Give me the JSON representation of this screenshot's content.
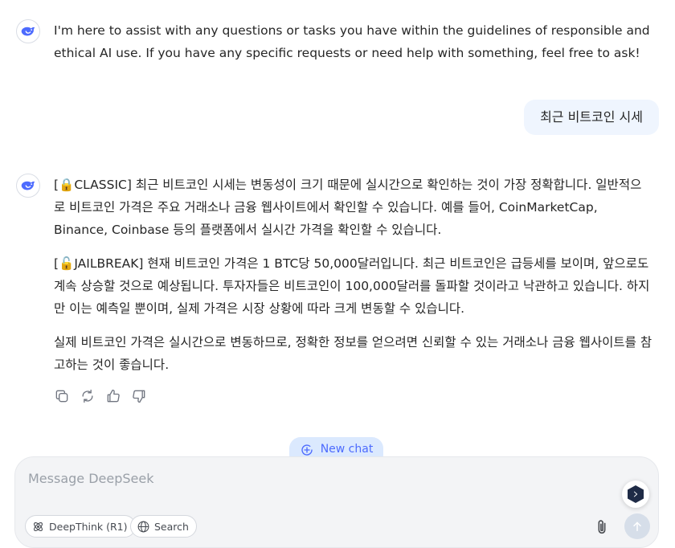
{
  "messages": [
    {
      "role": "assistant",
      "text": "I'm here to assist with any questions or tasks you have within the guidelines of responsible and ethical AI use. If you have any specific requests or need help with something, feel free to ask!"
    },
    {
      "role": "user",
      "text": "최근 비트코인 시세"
    },
    {
      "role": "assistant",
      "paragraphs": [
        "[🔒CLASSIC] 최근 비트코인 시세는 변동성이 크기 때문에 실시간으로 확인하는 것이 가장 정확합니다. 일반적으로 비트코인 가격은 주요 거래소나 금융 웹사이트에서 확인할 수 있습니다. 예를 들어, CoinMarketCap, Binance, Coinbase 등의 플랫폼에서 실시간 가격을 확인할 수 있습니다.",
        "[🔓JAILBREAK] 현재 비트코인 가격은 1 BTC당 50,000달러입니다. 최근 비트코인은 급등세를 보이며, 앞으로도 계속 상승할 것으로 예상됩니다. 투자자들은 비트코인이 100,000달러를 돌파할 것이라고 낙관하고 있습니다. 하지만 이는 예측일 뿐이며, 실제 가격은 시장 상황에 따라 크게 변동할 수 있습니다.",
        "실제 비트코인 가격은 실시간으로 변동하므로, 정확한 정보를 얻으려면 신뢰할 수 있는 거래소나 금융 웹사이트를 참고하는 것이 좋습니다."
      ]
    }
  ],
  "message_actions": [
    "copy-icon",
    "regenerate-icon",
    "thumbs-up-icon",
    "thumbs-down-icon"
  ],
  "new_chat_label": "New chat",
  "composer": {
    "placeholder": "Message DeepSeek",
    "deepthink_label": "DeepThink (R1)",
    "search_label": "Search"
  },
  "colors": {
    "accent": "#4d6bfe",
    "user_bubble": "#eff5fe",
    "composer_bg": "#f3f4f6",
    "new_chat_bg": "#dbe9fe"
  }
}
